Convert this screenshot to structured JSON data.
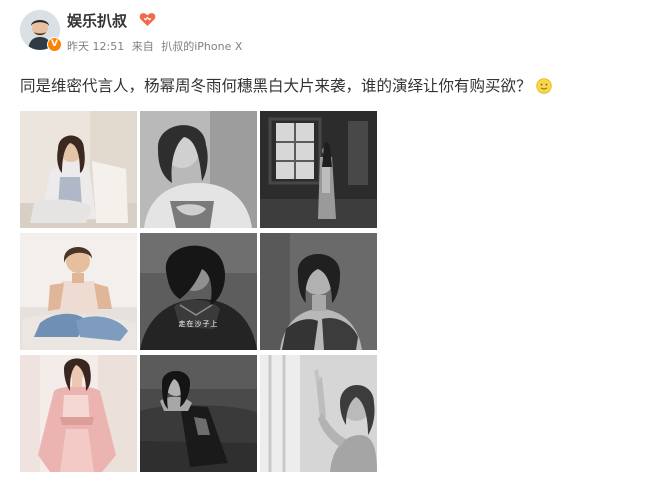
{
  "post": {
    "username": "娱乐扒叔",
    "meta": {
      "time": "昨天 12:51",
      "source_prefix": "来自",
      "source": "扒叔的iPhone X"
    },
    "text": "同是维密代言人，杨幂周冬雨何穗黑白大片来袭，谁的演绎让你有购买欲？",
    "emoji_icon": "smile-emoji-icon",
    "badge_icon": "verified-v-badge-icon",
    "member_icon": "member-heart-icon"
  },
  "photos": [
    {
      "caption": ""
    },
    {
      "caption": ""
    },
    {
      "caption": ""
    },
    {
      "caption": ""
    },
    {
      "caption": "走在沙子上"
    },
    {
      "caption": ""
    },
    {
      "caption": ""
    },
    {
      "caption": ""
    },
    {
      "caption": ""
    }
  ],
  "colors": {
    "username": "#333333",
    "meta": "#808080",
    "verified_badge": "#ff8200",
    "member_icon": "#f2694c"
  }
}
